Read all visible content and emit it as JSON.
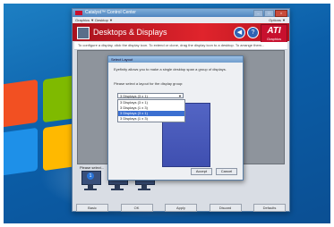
{
  "app": {
    "window_title": "Catalyst™ Control Center",
    "menu_left": "Graphics ▼  Desktop ▼",
    "menu_right": "Options ▼",
    "header_title": "Desktops & Displays",
    "brand_big": "ATI",
    "brand_small": "Graphics",
    "description": "To configure a display, click the display icon. To extend or clone, drag the display icon to a desktop. To arrange them...",
    "monitors_label": "Please select...",
    "monitor_numbers": [
      "1",
      "2",
      "3"
    ],
    "bottom_buttons": [
      "Basic",
      "OK",
      "Apply",
      "Discard",
      "Defaults"
    ]
  },
  "dialog": {
    "title": "Select Layout",
    "text_1": "Eyefinity allows you to make a single desktop span a group of displays.",
    "text_2": "Please select a layout for the display group:",
    "selected_value": "3 Displays (3 x 1)",
    "options": [
      "3 Displays (3 x 1)",
      "3 Displays (1 x 3)",
      "3 Displays (3 x 1)",
      "3 Displays (1 x 3)"
    ],
    "selected_index": 2,
    "accept": "Accept",
    "cancel": "Cancel"
  },
  "colors": {
    "header_red": "#e0242c",
    "preview_blue": "#4b5cbd"
  }
}
